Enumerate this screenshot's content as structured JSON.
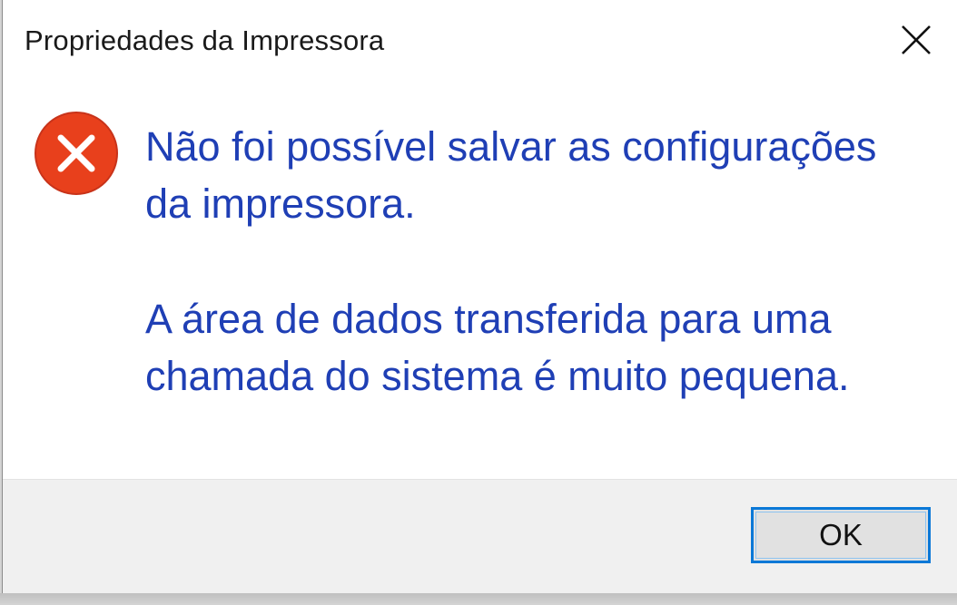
{
  "window": {
    "title": "Propriedades da Impressora",
    "close_icon": "close-icon"
  },
  "message": {
    "icon": "error-icon",
    "icon_color": "#e8401c",
    "text_color": "#1f3fb5",
    "line1": "Não foi possível salvar as configurações",
    "line2": "da impressora.",
    "line3": "A área de dados transferida para uma",
    "line4": "chamada do sistema é muito pequena."
  },
  "footer": {
    "ok_label": "OK",
    "accent": "#0a78d7"
  }
}
